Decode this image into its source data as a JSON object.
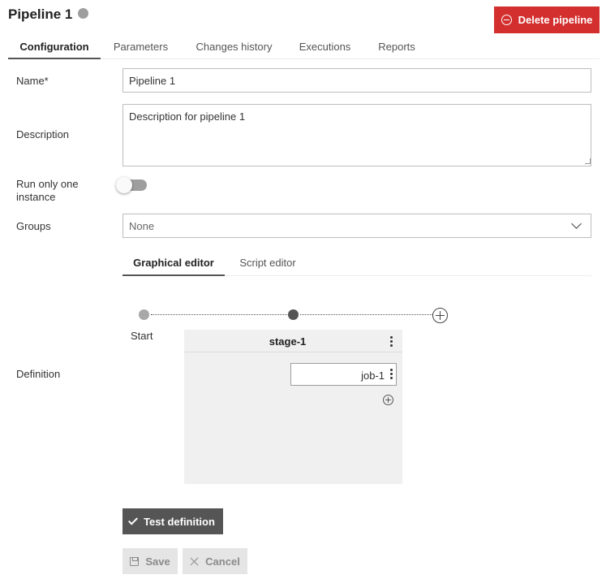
{
  "header": {
    "title": "Pipeline 1",
    "status_color": "#9e9e9e",
    "delete_label": "Delete pipeline",
    "delete_color": "#d32f2f"
  },
  "tabs": [
    {
      "label": "Configuration",
      "active": true
    },
    {
      "label": "Parameters",
      "active": false
    },
    {
      "label": "Changes history",
      "active": false
    },
    {
      "label": "Executions",
      "active": false
    },
    {
      "label": "Reports",
      "active": false
    }
  ],
  "form": {
    "name_label": "Name*",
    "name_value": "Pipeline 1",
    "description_label": "Description",
    "description_value": "Description for pipeline 1",
    "run_once_label": "Run only one instance",
    "run_once_enabled": false,
    "groups_label": "Groups",
    "groups_value": "None",
    "definition_label": "Definition"
  },
  "editor_tabs": [
    {
      "label": "Graphical editor",
      "active": true
    },
    {
      "label": "Script editor",
      "active": false
    }
  ],
  "graph": {
    "start_label": "Start",
    "stages": [
      {
        "name": "stage-1",
        "jobs": [
          {
            "name": "job-1"
          }
        ]
      }
    ]
  },
  "actions": {
    "test_label": "Test definition",
    "save_label": "Save",
    "cancel_label": "Cancel"
  }
}
